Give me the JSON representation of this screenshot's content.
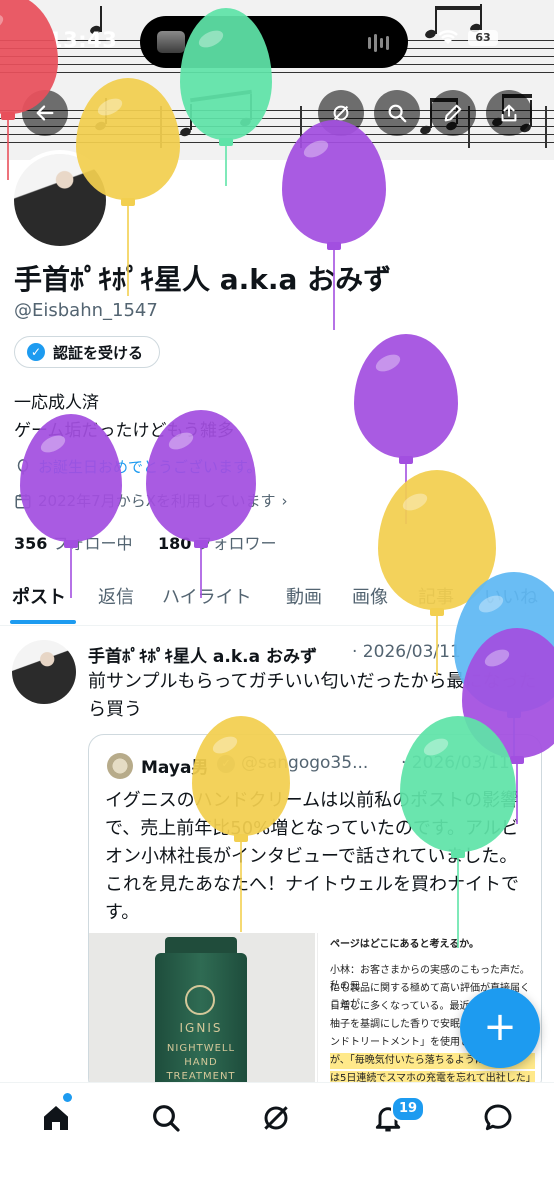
{
  "status_bar": {
    "time": "13:43",
    "battery": "63"
  },
  "header": {
    "buttons": [
      "back",
      "grok",
      "search",
      "edit",
      "share"
    ]
  },
  "profile": {
    "display_name": "手首ﾎﾟｷﾎﾟｷ星人 a.k.a おみず",
    "handle": "@Eisbahn_1547",
    "verify_label": "認証を受ける",
    "bio_line1": "一応成人済",
    "bio_line2": "ゲーム垢だったけどもう雑多",
    "birthday_text": "お誕生日おめでとうございます。",
    "joined_text": "2022年7月からXを利用しています",
    "following_count": "356",
    "following_label": "フォロー中",
    "followers_count": "180",
    "followers_label": "フォロワー"
  },
  "tabs": [
    "ポスト",
    "返信",
    "ハイライト",
    "動画",
    "画像",
    "記事",
    "いいね"
  ],
  "post": {
    "author": "手首ﾎﾟｷﾎﾟｷ星人 a.k.a おみず",
    "date": "· 2026/03/11",
    "text": "前サンプルもらってガチいい匂いだったから最になったら買う",
    "quote": {
      "author": "Maya男",
      "handle": "@sangogo35...",
      "date": "· 2026/03/11",
      "text": "イグニスのハンドクリームは以前私のポストの影響で、売上前年比50%増となっていたのです。アルビオン小林社長がインタビューで話されていました。これを見たあなたへ！ナイトウェルを買わナイトです。",
      "product_brand": "IGNIS",
      "product_line1": "NIGHTWELL",
      "product_line2": "HAND",
      "product_line3": "TREATMENT",
      "article_heading": "ページはどこにあると考えるか。",
      "article_line1": "小林：お客さまからの実感のこもった声だ。私の元",
      "article_line2": "にも製品に関する極めて高い評価が直接届くことが",
      "article_line3": "日増しに多くなっている。最近も、「",
      "article_line4": "柚子を基調にした香りで安眠に誘う",
      "article_line5": "ンドトリートメント」を使用してくれ",
      "article_line6": "が、「毎晩気付いたら落ちるように寝",
      "article_line7": "は5日連続でスマホの充電を忘れて出社した」と Xに"
    }
  },
  "fab_label": "+",
  "bottom_nav": {
    "notifications_badge": "19"
  },
  "colors": {
    "accent": "#1d9bf0",
    "text": "#0f1419",
    "secondary": "#536471"
  }
}
